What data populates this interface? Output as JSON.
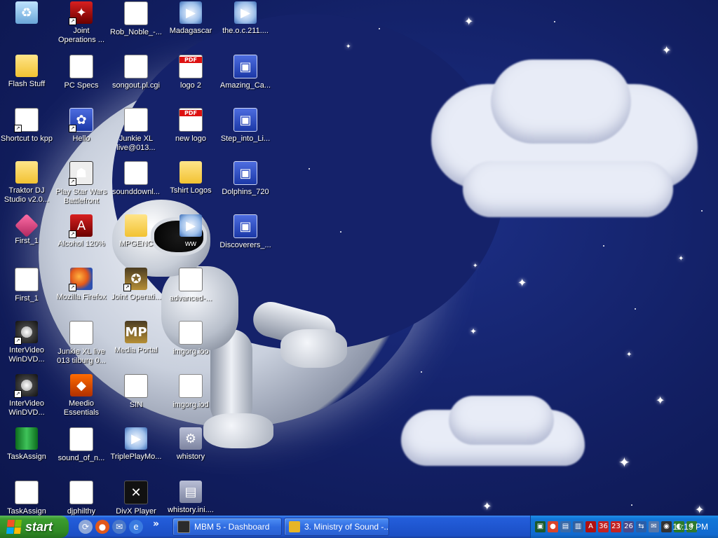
{
  "desktop": {
    "icons": [
      {
        "label": "",
        "name": "recycle-bin-icon",
        "kind": "k-trash",
        "glyph": "♻",
        "shortcut": false
      },
      {
        "label": "Joint Operations ...",
        "name": "joint-operations-icon",
        "kind": "k-red",
        "glyph": "✦",
        "shortcut": true
      },
      {
        "label": "Rob_Noble_-...",
        "name": "rob-noble-icon",
        "kind": "k-winamp",
        "glyph": "⚡",
        "shortcut": false
      },
      {
        "label": "Madagascar",
        "name": "madagascar-icon",
        "kind": "k-media",
        "glyph": "▶",
        "shortcut": false
      },
      {
        "label": "the.o.c.211....",
        "name": "the-oc-icon",
        "kind": "k-media",
        "glyph": "▶",
        "shortcut": false
      },
      {
        "label": "Flash Stuff",
        "name": "flash-stuff-folder-icon",
        "kind": "k-folder",
        "glyph": "",
        "shortcut": false
      },
      {
        "label": "PC Specs",
        "name": "pc-specs-icon",
        "kind": "k-doc",
        "glyph": "≡",
        "shortcut": false
      },
      {
        "label": "songout.pl.cgi",
        "name": "songout-icon",
        "kind": "k-winamp",
        "glyph": "⚡",
        "shortcut": false
      },
      {
        "label": "logo 2",
        "name": "logo-2-pdf-icon",
        "kind": "k-pdf",
        "glyph": "",
        "shortcut": false
      },
      {
        "label": "Amazing_Ca...",
        "name": "amazing-ca-icon",
        "kind": "k-app",
        "glyph": "▣",
        "shortcut": false
      },
      {
        "label": "Shortcut to kpp",
        "name": "shortcut-kpp-icon",
        "kind": "k-doc",
        "glyph": "▭",
        "shortcut": true
      },
      {
        "label": "Hello",
        "name": "hello-icon",
        "kind": "k-app",
        "glyph": "✿",
        "shortcut": true
      },
      {
        "label": "Junkie XL live@013...",
        "name": "junkie-xl-live-icon",
        "kind": "k-winamp",
        "glyph": "⚡",
        "shortcut": false
      },
      {
        "label": "new logo",
        "name": "new-logo-pdf-icon",
        "kind": "k-pdf",
        "glyph": "",
        "shortcut": false
      },
      {
        "label": "Step_into_Li...",
        "name": "step-into-li-icon",
        "kind": "k-app",
        "glyph": "▣",
        "shortcut": false
      },
      {
        "label": "Traktor DJ Studio v2.0...",
        "name": "traktor-folder-icon",
        "kind": "k-folder",
        "glyph": "",
        "shortcut": false
      },
      {
        "label": "Play Star Wars Battlefront",
        "name": "star-wars-battlefront-icon",
        "kind": "k-trooper",
        "glyph": "☗",
        "shortcut": true
      },
      {
        "label": "sounddownl...",
        "name": "sounddownl-wav-icon",
        "kind": "k-wav",
        "glyph": "♫",
        "shortcut": false
      },
      {
        "label": "Tshirt Logos",
        "name": "tshirt-logos-folder-icon",
        "kind": "k-folder",
        "glyph": "",
        "shortcut": false
      },
      {
        "label": "Dolphins_720",
        "name": "dolphins-720-icon",
        "kind": "k-app",
        "glyph": "▣",
        "shortcut": false
      },
      {
        "label": "First_1",
        "name": "first-1-app-icon",
        "kind": "k-pink",
        "glyph": "",
        "shortcut": false
      },
      {
        "label": "Alcohol 120%",
        "name": "alcohol-120-icon",
        "kind": "k-red",
        "glyph": "A",
        "shortcut": true
      },
      {
        "label": "MPGENC",
        "name": "mpgenc-folder-icon",
        "kind": "k-folder",
        "glyph": "",
        "shortcut": false
      },
      {
        "label": "ww",
        "name": "ww-media-icon",
        "kind": "k-media",
        "glyph": "▶",
        "shortcut": false
      },
      {
        "label": "Discoverers_...",
        "name": "discoverers-icon",
        "kind": "k-app",
        "glyph": "▣",
        "shortcut": false
      },
      {
        "label": "First_1",
        "name": "first-1-doc-icon",
        "kind": "k-doc",
        "glyph": "▤",
        "shortcut": false
      },
      {
        "label": "Mozilla Firefox",
        "name": "firefox-icon",
        "kind": "k-ffx",
        "glyph": "",
        "shortcut": true
      },
      {
        "label": "Joint Operati...",
        "name": "joint-operations-2-icon",
        "kind": "k-mp",
        "glyph": "✪",
        "shortcut": true
      },
      {
        "label": "advanced-...",
        "name": "advanced-doc-icon",
        "kind": "k-doc",
        "glyph": "▤",
        "shortcut": false
      },
      {
        "label": "InterVideo WinDVD...",
        "name": "intervideo-windvd-icon",
        "kind": "k-dvd",
        "glyph": "",
        "shortcut": true
      },
      {
        "label": "Junkie XL live 013 tilburg 0...",
        "name": "junkie-xl-tilburg-icon",
        "kind": "k-doc",
        "glyph": "◖",
        "shortcut": false
      },
      {
        "label": "Media Portal",
        "name": "media-portal-icon",
        "kind": "k-mp",
        "glyph": "MP",
        "shortcut": false
      },
      {
        "label": "imgorg.ioo",
        "name": "imgorg-ioo-icon",
        "kind": "k-img",
        "glyph": "▦",
        "shortcut": false
      },
      {
        "label": "InterVideo WinDVD...",
        "name": "intervideo-windvd-2-icon",
        "kind": "k-dvd",
        "glyph": "",
        "shortcut": true
      },
      {
        "label": "Meedio Essentials",
        "name": "meedio-essentials-icon",
        "kind": "k-meedio",
        "glyph": "◆",
        "shortcut": false
      },
      {
        "label": "SIN",
        "name": "sin-doc-icon",
        "kind": "k-doc",
        "glyph": "≡",
        "shortcut": false
      },
      {
        "label": "imgorg.iod",
        "name": "imgorg-iod-icon",
        "kind": "k-img",
        "glyph": "▦",
        "shortcut": false
      },
      {
        "label": "TaskAssign",
        "name": "taskassign-icon",
        "kind": "k-green",
        "glyph": "",
        "shortcut": false
      },
      {
        "label": "sound_of_n...",
        "name": "sound-of-n-icon",
        "kind": "k-winamp",
        "glyph": "⚡",
        "shortcut": false
      },
      {
        "label": "TriplePlayMo...",
        "name": "tripleplaymo-icon",
        "kind": "k-media",
        "glyph": "▶",
        "shortcut": false
      },
      {
        "label": "whistory",
        "name": "whistory-icon",
        "kind": "k-ini",
        "glyph": "⚙",
        "shortcut": false
      },
      {
        "label": "TaskAssign",
        "name": "taskassign-2-icon",
        "kind": "k-doc",
        "glyph": "✎",
        "shortcut": false
      },
      {
        "label": "djphilthy",
        "name": "djphilthy-icon",
        "kind": "k-winamp",
        "glyph": "⚡",
        "shortcut": false
      },
      {
        "label": "DivX Player",
        "name": "divx-player-icon",
        "kind": "k-divx",
        "glyph": "✕",
        "shortcut": false
      },
      {
        "label": "whistory.ini....",
        "name": "whistory-ini-icon",
        "kind": "k-ini",
        "glyph": "▤",
        "shortcut": false
      }
    ]
  },
  "taskbar": {
    "start_label": "start",
    "quick_launch": [
      {
        "name": "show-desktop-icon",
        "glyph": "⟳",
        "color": "#8fa8d8"
      },
      {
        "name": "firefox-quicklaunch-icon",
        "glyph": "●",
        "color": "#e2581a"
      },
      {
        "name": "outlook-quicklaunch-icon",
        "glyph": "✉",
        "color": "#4a78c9"
      },
      {
        "name": "ie-quicklaunch-icon",
        "glyph": "e",
        "color": "#3a7be0"
      }
    ],
    "quick_launch_more": "»",
    "tasks": [
      {
        "label": "MBM 5 - Dashboard",
        "name": "task-mbm5-dashboard",
        "color": "#2b2b2b"
      },
      {
        "label": "3. Ministry of Sound -...",
        "name": "task-ministry-of-sound",
        "color": "#e7b526"
      }
    ],
    "tray": {
      "icons": [
        {
          "name": "tray-app-1-icon",
          "glyph": "▣",
          "color": "#1b5a2d"
        },
        {
          "name": "tray-chrome-icon",
          "glyph": "●",
          "color": "#d8442a"
        },
        {
          "name": "tray-app-3-icon",
          "glyph": "▤",
          "color": "#3a6aa8"
        },
        {
          "name": "tray-app-4-icon",
          "glyph": "▥",
          "color": "#3060a0"
        },
        {
          "name": "tray-alcohol-icon",
          "glyph": "A",
          "color": "#b01010"
        },
        {
          "name": "tray-temp-36-icon",
          "glyph": "36",
          "color": "#c42222"
        },
        {
          "name": "tray-temp-23-icon",
          "glyph": "23",
          "color": "#c42222"
        },
        {
          "name": "tray-temp-26-icon",
          "glyph": "26",
          "color": "#4a4a8a"
        },
        {
          "name": "tray-network-icon",
          "glyph": "⇆",
          "color": "#2a5ea8"
        },
        {
          "name": "tray-mail-icon",
          "glyph": "✉",
          "color": "#5577aa"
        },
        {
          "name": "tray-security-icon",
          "glyph": "◉",
          "color": "#333333"
        },
        {
          "name": "tray-volume-icon",
          "glyph": "◐",
          "color": "#2a7a2a"
        },
        {
          "name": "tray-safely-remove-icon",
          "glyph": "⚘",
          "color": "#2f7a2f"
        }
      ],
      "clock": "11:19 PM"
    }
  }
}
